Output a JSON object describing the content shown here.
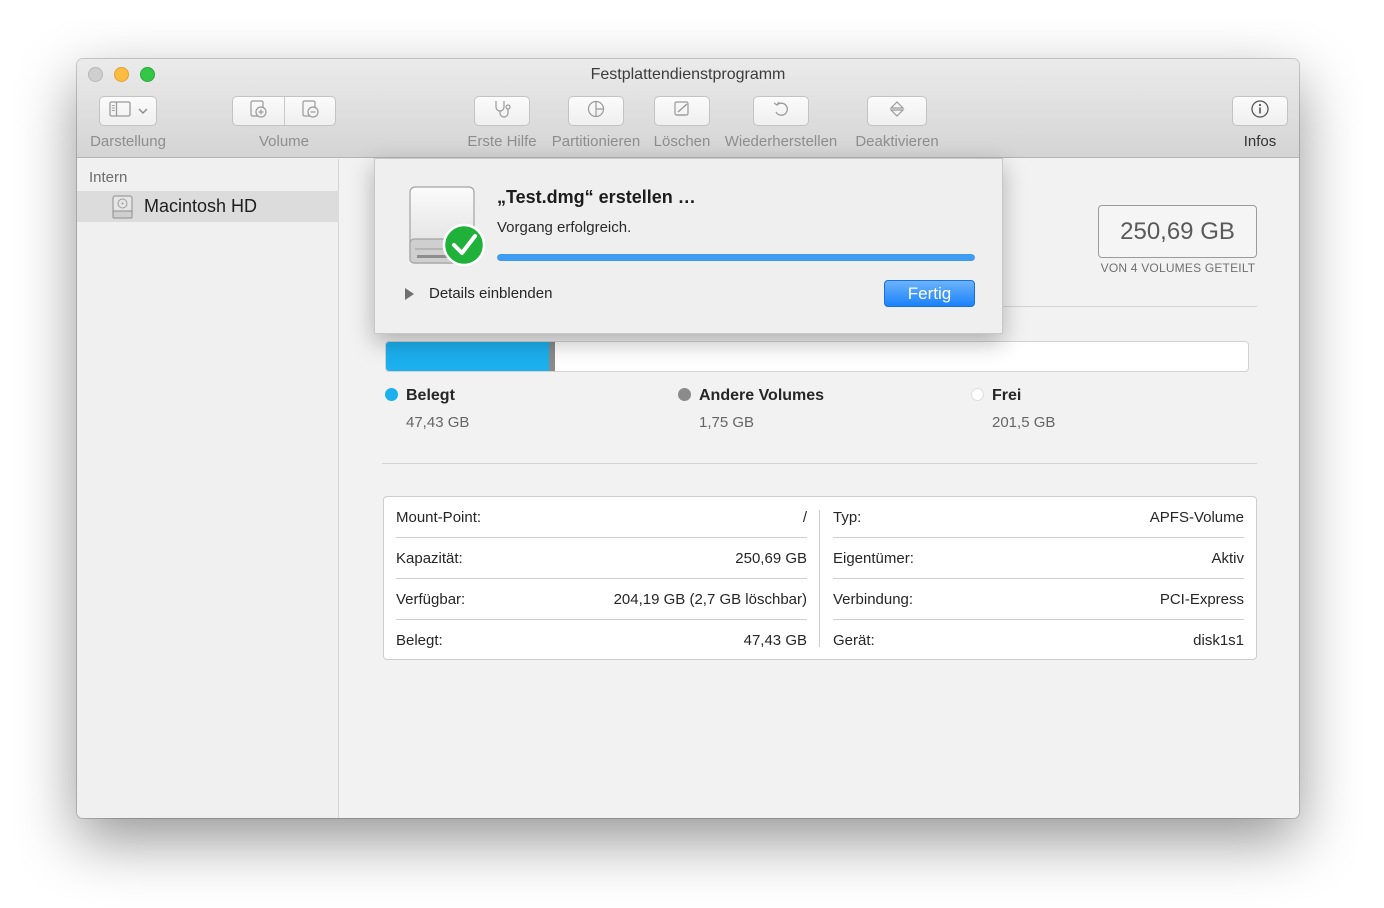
{
  "window": {
    "title": "Festplattendienstprogramm"
  },
  "toolbar": {
    "view_label": "Darstellung",
    "volume_label": "Volume",
    "first_aid_label": "Erste Hilfe",
    "partition_label": "Partitionieren",
    "erase_label": "Löschen",
    "restore_label": "Wiederherstellen",
    "unmount_label": "Deaktivieren",
    "info_label": "Infos",
    "icons": [
      "sidebar-icon",
      "add-volume-icon",
      "remove-volume-icon",
      "stethoscope-icon",
      "pie-chart-icon",
      "erase-icon",
      "restore-icon",
      "eject-icon",
      "info-icon"
    ]
  },
  "sidebar": {
    "section": "Intern",
    "items": [
      {
        "label": "Macintosh HD",
        "icon": "hard-drive-icon"
      }
    ]
  },
  "volume": {
    "capacity": "250,69 GB",
    "capacity_note": "VON 4 VOLUMES GETEILT"
  },
  "usage": {
    "used_fraction": 0.1892,
    "other_fraction": 0.007,
    "colors": {
      "used": "#1cb0ef",
      "other": "#8b8b8b",
      "free": "#ffffff"
    },
    "legend": [
      {
        "name": "Belegt",
        "value": "47,43 GB",
        "color": "#1cb0ef"
      },
      {
        "name": "Andere Volumes",
        "value": "1,75 GB",
        "color": "#8b8b8b"
      },
      {
        "name": "Frei",
        "value": "201,5 GB",
        "color": "#ffffff"
      }
    ]
  },
  "info": {
    "left": [
      {
        "label": "Mount-Point:",
        "value": "/"
      },
      {
        "label": "Kapazität:",
        "value": "250,69 GB"
      },
      {
        "label": "Verfügbar:",
        "value": "204,19 GB (2,7 GB löschbar)"
      },
      {
        "label": "Belegt:",
        "value": "47,43 GB"
      }
    ],
    "right": [
      {
        "label": "Typ:",
        "value": "APFS-Volume"
      },
      {
        "label": "Eigentümer:",
        "value": "Aktiv"
      },
      {
        "label": "Verbindung:",
        "value": "PCI-Express"
      },
      {
        "label": "Gerät:",
        "value": "disk1s1"
      }
    ]
  },
  "sheet": {
    "title": "„Test.dmg“ erstellen …",
    "status": "Vorgang erfolgreich.",
    "progress": 1.0,
    "details_label": "Details einblenden",
    "done_label": "Fertig",
    "accent": "#3f9cf3",
    "success_color": "#1fb13a"
  }
}
